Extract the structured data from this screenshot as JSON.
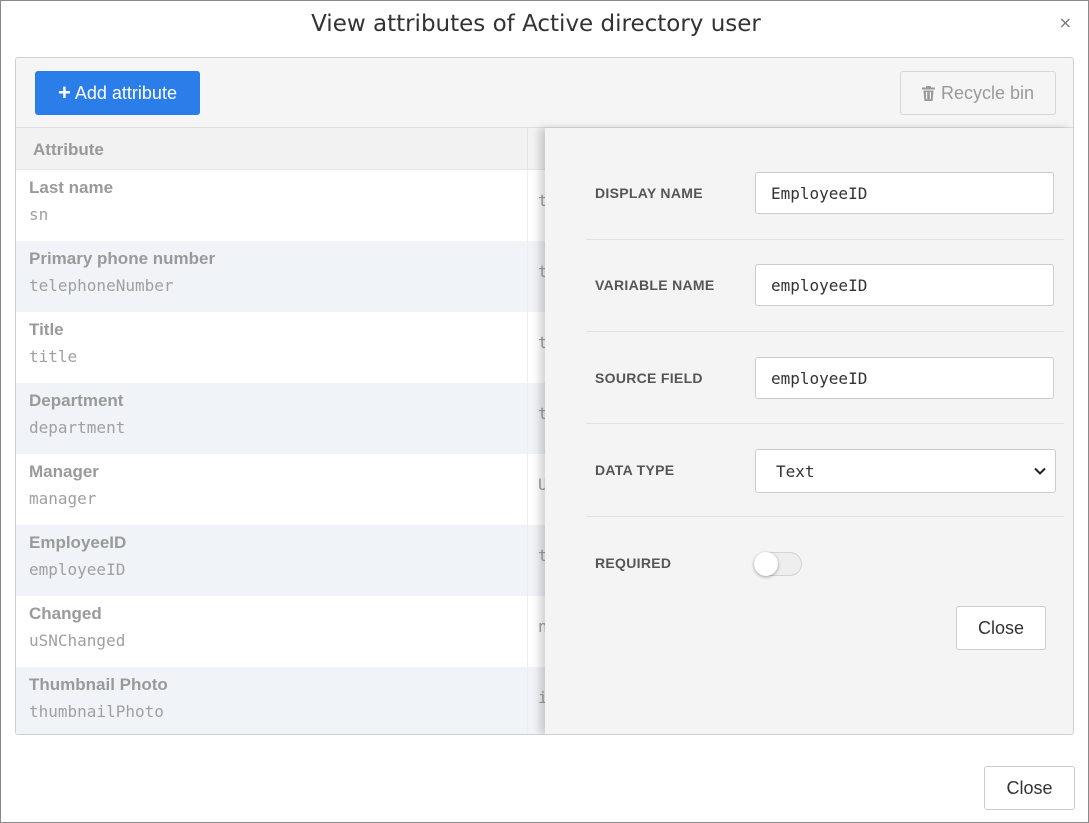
{
  "dialog": {
    "title": "View attributes of Active directory user",
    "close_glyph": "×"
  },
  "toolbar": {
    "add_icon": "plus-icon",
    "add_label": "Add attribute",
    "recycle_icon": "trash-icon",
    "recycle_label": "Recycle bin"
  },
  "table": {
    "header": "Attribute",
    "rows": [
      {
        "name": "Last name",
        "variable": "sn",
        "type": "t"
      },
      {
        "name": "Primary phone number",
        "variable": "telephoneNumber",
        "type": "t"
      },
      {
        "name": "Title",
        "variable": "title",
        "type": "t"
      },
      {
        "name": "Department",
        "variable": "department",
        "type": "t"
      },
      {
        "name": "Manager",
        "variable": "manager",
        "type": "U"
      },
      {
        "name": "EmployeeID",
        "variable": "employeeID",
        "type": "t"
      },
      {
        "name": "Changed",
        "variable": "uSNChanged",
        "type": "n"
      },
      {
        "name": "Thumbnail Photo",
        "variable": "thumbnailPhoto",
        "type": "i"
      }
    ]
  },
  "side_panel": {
    "display_name_label": "DISPLAY NAME",
    "display_name_value": "EmployeeID",
    "variable_name_label": "VARIABLE NAME",
    "variable_name_value": "employeeID",
    "source_field_label": "SOURCE FIELD",
    "source_field_value": "employeeID",
    "data_type_label": "DATA TYPE",
    "data_type_value": "Text",
    "required_label": "REQUIRED",
    "required_on": false,
    "close_label": "Close"
  },
  "footer": {
    "close_label": "Close"
  },
  "colors": {
    "accent": "#2b7de9",
    "row_alt": "#f0f3f7",
    "panel_bg": "#f4f4f4"
  }
}
